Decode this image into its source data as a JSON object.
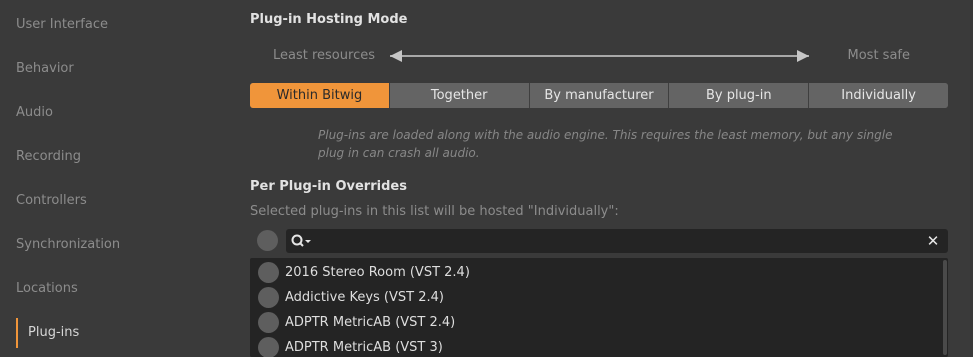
{
  "sidebar": {
    "items": [
      {
        "label": "User Interface"
      },
      {
        "label": "Behavior"
      },
      {
        "label": "Audio"
      },
      {
        "label": "Recording"
      },
      {
        "label": "Controllers"
      },
      {
        "label": "Synchronization"
      },
      {
        "label": "Locations"
      },
      {
        "label": "Plug-ins",
        "active": true
      }
    ]
  },
  "hosting": {
    "title": "Plug-in Hosting Mode",
    "slider_left": "Least resources",
    "slider_right": "Most safe",
    "modes": [
      "Within Bitwig",
      "Together",
      "By manufacturer",
      "By plug-in",
      "Individually"
    ],
    "selected_mode": "Within Bitwig",
    "description": "Plug-ins are loaded along with the audio engine. This requires the least memory, but any single plug in can crash all audio."
  },
  "overrides": {
    "title": "Per Plug-in Overrides",
    "hint": "Selected plug-ins in this list will be hosted \"Individually\":",
    "search": {
      "value": "",
      "placeholder": ""
    },
    "plugins": [
      "2016 Stereo Room (VST 2.4)",
      "Addictive Keys (VST 2.4)",
      "ADPTR MetricAB (VST 2.4)",
      "ADPTR MetricAB (VST 3)"
    ]
  },
  "colors": {
    "accent": "#f0953a",
    "background": "#3a3a3a",
    "panel": "#242424"
  }
}
